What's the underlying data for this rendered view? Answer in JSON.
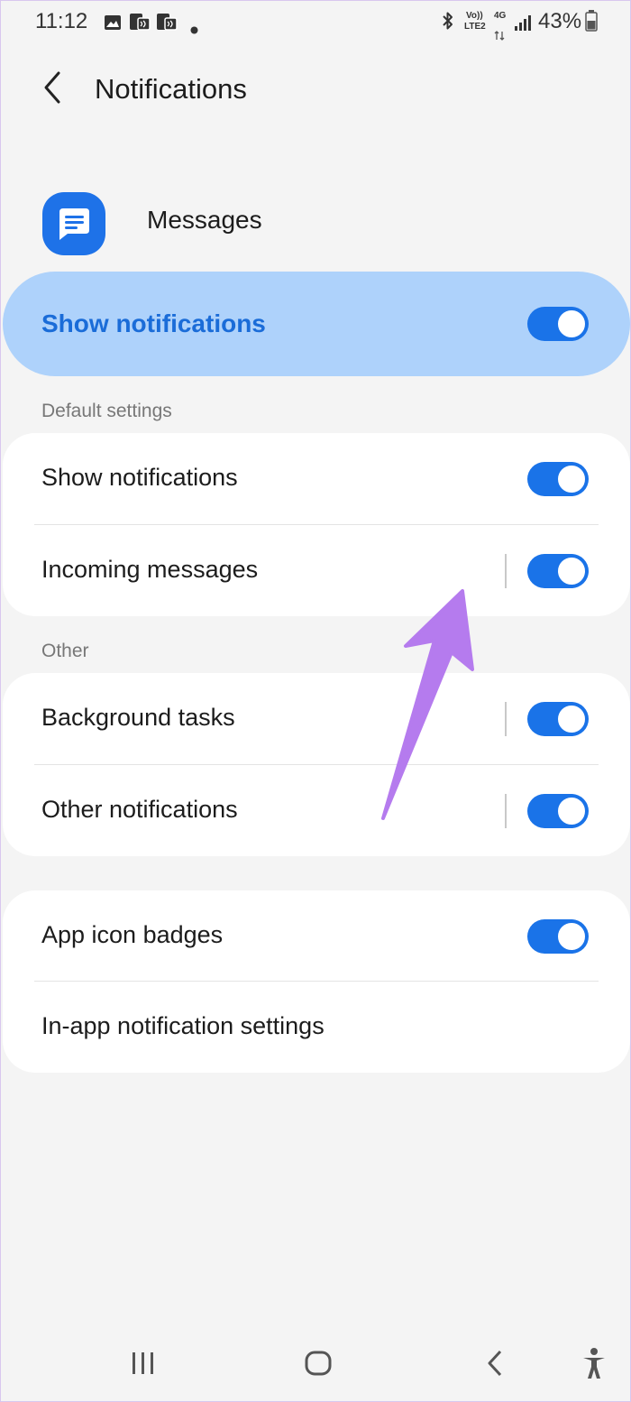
{
  "status_bar": {
    "time": "11:12",
    "volte": "Vo))",
    "lte": "LTE2",
    "network": "4G",
    "battery": "43%",
    "icons": [
      "gallery-icon",
      "nfc-icon",
      "nfc-icon",
      "dot-icon",
      "bluetooth-icon",
      "signal-icon",
      "battery-icon"
    ]
  },
  "header": {
    "title": "Notifications",
    "back_icon": "chevron-left-icon"
  },
  "app": {
    "name": "Messages",
    "icon": "messages-icon",
    "icon_color": "#1e72e8"
  },
  "master": {
    "label": "Show notifications",
    "enabled": true
  },
  "sections": [
    {
      "header": "Default settings",
      "rows": [
        {
          "label": "Show notifications",
          "enabled": true
        },
        {
          "label": "Incoming messages",
          "enabled": true
        }
      ]
    },
    {
      "header": "Other",
      "rows": [
        {
          "label": "Background tasks",
          "enabled": true
        },
        {
          "label": "Other notifications",
          "enabled": true
        }
      ]
    },
    {
      "header": "",
      "rows": [
        {
          "label": "App icon badges",
          "enabled": true
        },
        {
          "label": "In-app notification settings"
        }
      ]
    }
  ],
  "nav": {
    "icons": [
      "recents-icon",
      "home-icon",
      "back-icon",
      "accessibility-icon"
    ]
  },
  "colors": {
    "accent": "#1a73e8",
    "highlight": "#aed2fb",
    "annotation_arrow": "#b57bee"
  }
}
